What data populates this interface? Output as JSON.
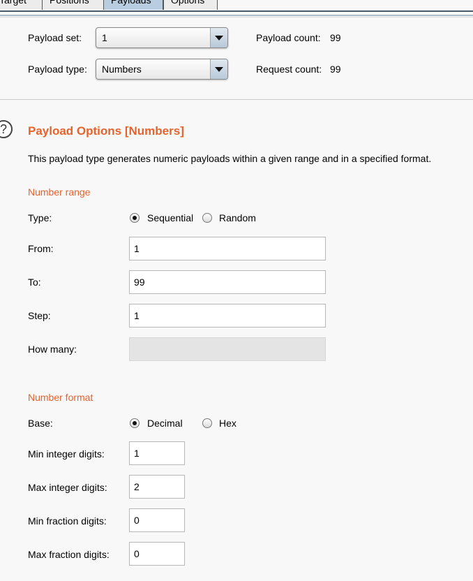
{
  "tabs": [
    {
      "label": "Target"
    },
    {
      "label": "Positions"
    },
    {
      "label": "Payloads"
    },
    {
      "label": "Options"
    }
  ],
  "payload_set": {
    "label": "Payload set:",
    "value": "1"
  },
  "payload_type": {
    "label": "Payload type:",
    "value": "Numbers"
  },
  "payload_count": {
    "label": "Payload count:",
    "value": "99"
  },
  "request_count": {
    "label": "Request count:",
    "value": "99"
  },
  "payload_options": {
    "title": "Payload Options [Numbers]",
    "description": "This payload type generates numeric payloads within a given range and in a specified format.",
    "help_icon": "help-icon"
  },
  "number_range": {
    "heading": "Number range",
    "type_label": "Type:",
    "type_options": [
      "Sequential",
      "Random"
    ],
    "type_selected": "Sequential",
    "from_label": "From:",
    "from_value": "1",
    "to_label": "To:",
    "to_value": "99",
    "step_label": "Step:",
    "step_value": "1",
    "how_many_label": "How many:",
    "how_many_value": ""
  },
  "number_format": {
    "heading": "Number format",
    "base_label": "Base:",
    "base_options": [
      "Decimal",
      "Hex"
    ],
    "base_selected": "Decimal",
    "min_integer_label": "Min integer digits:",
    "min_integer_value": "1",
    "max_integer_label": "Max integer digits:",
    "max_integer_value": "2",
    "min_fraction_label": "Min fraction digits:",
    "min_fraction_value": "0",
    "max_fraction_label": "Max fraction digits:",
    "max_fraction_value": "0"
  },
  "colors": {
    "accent": "#e8622c",
    "active_tab": "#b9cde0"
  }
}
